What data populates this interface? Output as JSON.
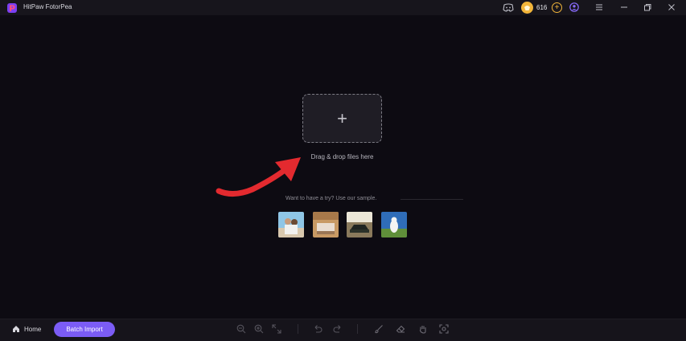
{
  "window": {
    "title": "HitPaw FotorPea",
    "coins": "616"
  },
  "main": {
    "dropzone_label": "Drag & drop files here",
    "sample_prompt": "Want to have a try? Use our sample."
  },
  "samples": [
    {
      "name": "sample-couple"
    },
    {
      "name": "sample-sofa"
    },
    {
      "name": "sample-car"
    },
    {
      "name": "sample-dog"
    }
  ],
  "footer": {
    "home_label": "Home",
    "batch_import_label": "Batch Import"
  },
  "colors": {
    "accent": "#7b5cf5",
    "coin": "#f2b53a",
    "arrow": "#e32a2f",
    "background": "#0d0b12"
  },
  "icons": [
    "app-logo",
    "discord-icon",
    "coin-icon",
    "add-coin-icon",
    "user-icon",
    "menu-icon",
    "minimize-icon",
    "restore-icon",
    "close-icon",
    "plus-icon",
    "home-icon",
    "zoom-out-icon",
    "zoom-in-icon",
    "fit-screen-icon",
    "undo-icon",
    "redo-icon",
    "brush-icon",
    "eraser-icon",
    "hand-icon",
    "focus-icon"
  ]
}
